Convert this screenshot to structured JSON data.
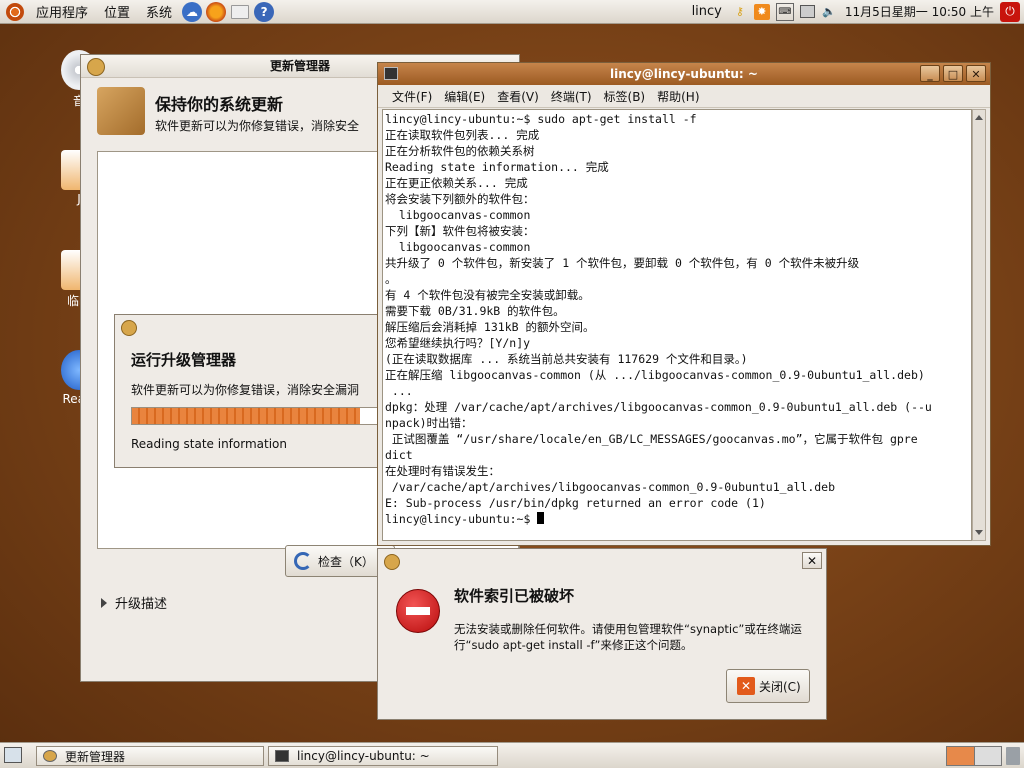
{
  "top_panel": {
    "menus": [
      "应用程序",
      "位置",
      "系统"
    ],
    "username": "lincy",
    "clock": "11月5日星期一 10:50 上午"
  },
  "desktop_icons": [
    {
      "label": "音"
    },
    {
      "label": "J"
    },
    {
      "label": "临时"
    },
    {
      "label": "RealP"
    }
  ],
  "update_manager": {
    "title": "更新管理器",
    "heading": "保持你的系统更新",
    "description": "软件更新可以为你修复错误，消除安全",
    "check_button": "检查（K）",
    "expander": "升级描述"
  },
  "progress_dialog": {
    "title": "运行升级管理器",
    "description": "软件更新可以为你修复错误，消除安全漏洞",
    "status": "Reading state information",
    "progress_fraction": 0.92
  },
  "terminal": {
    "title": "lincy@lincy-ubuntu: ~",
    "menu": [
      "文件(F)",
      "编辑(E)",
      "查看(V)",
      "终端(T)",
      "标签(B)",
      "帮助(H)"
    ],
    "lines": [
      "lincy@lincy-ubuntu:~$ sudo apt-get install -f",
      "正在读取软件包列表... 完成",
      "正在分析软件包的依赖关系树",
      "Reading state information... 完成",
      "正在更正依赖关系... 完成",
      "将会安装下列额外的软件包：",
      "  libgoocanvas-common",
      "下列【新】软件包将被安装：",
      "  libgoocanvas-common",
      "共升级了 0 个软件包，新安装了 1 个软件包，要卸载 0 个软件包，有 0 个软件未被升级",
      "。",
      "有 4 个软件包没有被完全安装或卸载。",
      "需要下载 0B/31.9kB 的软件包。",
      "解压缩后会消耗掉 131kB 的额外空间。",
      "您希望继续执行吗？[Y/n]y",
      "(正在读取数据库 ... 系统当前总共安装有 117629 个文件和目录。)",
      "正在解压缩 libgoocanvas-common (从 .../libgoocanvas-common_0.9-0ubuntu1_all.deb)",
      " ...",
      "dpkg：处理 /var/cache/apt/archives/libgoocanvas-common_0.9-0ubuntu1_all.deb (--u",
      "npack)时出错：",
      " 正试图覆盖 “/usr/share/locale/en_GB/LC_MESSAGES/goocanvas.mo”，它属于软件包 gpre",
      "dict",
      "在处理时有错误发生：",
      " /var/cache/apt/archives/libgoocanvas-common_0.9-0ubuntu1_all.deb",
      "E: Sub-process /usr/bin/dpkg returned an error code (1)"
    ],
    "prompt": "lincy@lincy-ubuntu:~$ "
  },
  "error_dialog": {
    "title": "软件索引已被破坏",
    "message": "无法安装或删除任何软件。请使用包管理软件“synaptic”或在终端运行“sudo apt-get install -f”来修正这个问题。",
    "close_button": "关闭(C)"
  },
  "bottom_panel": {
    "tasks": [
      "更新管理器",
      "lincy@lincy-ubuntu: ~"
    ]
  },
  "colors": {
    "accent": "#e1711d",
    "terminal_titlebar": "#b06b32",
    "desktop": "#7c4418"
  }
}
